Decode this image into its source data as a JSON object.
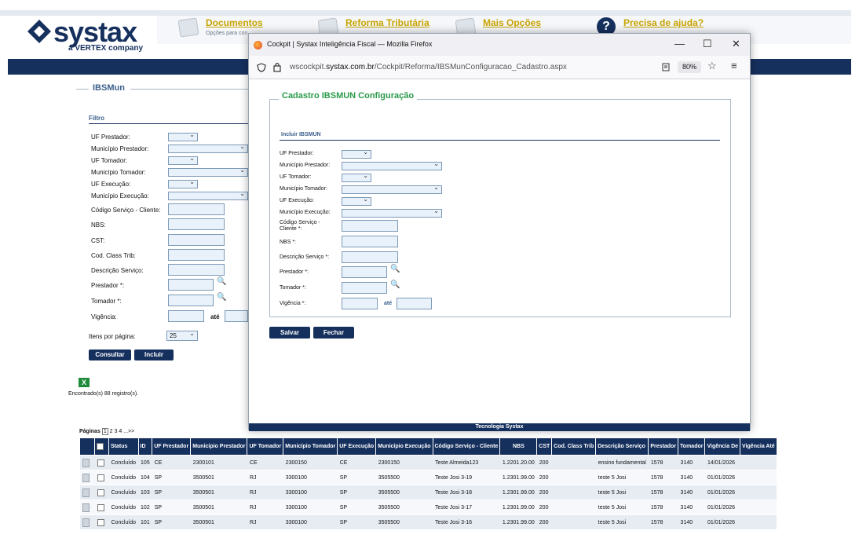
{
  "brand": {
    "name": "systax",
    "sub": "a VERTEX company"
  },
  "topnav": [
    {
      "title": "Documentos",
      "sub": "Opções para con"
    },
    {
      "title": "Reforma Tributária",
      "sub": ""
    },
    {
      "title": "Mais Opções",
      "sub": ""
    },
    {
      "title": "Precisa de ajuda?",
      "sub": ""
    }
  ],
  "help_glyph": "?",
  "filter": {
    "panel_title": "IBSMun",
    "section": "Filtro",
    "labels": [
      "UF Prestador:",
      "Município Prestador:",
      "UF Tomador:",
      "Município Tomador:",
      "UF Execução:",
      "Município Execução:",
      "Código Serviço - Cliente:",
      "NBS:",
      "CST:",
      "Cod. Class Trib:",
      "Descrição Serviço:",
      "Prestador *:",
      "Tomador *:",
      "Vigência:"
    ],
    "ate": "até",
    "itens_label": "Itens por página:",
    "itens_value": "25",
    "consultar": "Consultar",
    "incluir": "Incluir",
    "found": "Encontrado(s) 88 registro(s)."
  },
  "pages": {
    "label": "Páginas",
    "items": [
      "1",
      "2",
      "3",
      "4",
      "...",
      ">>"
    ]
  },
  "grid": {
    "headers": [
      "",
      "Status",
      "ID",
      "UF Prestador",
      "Município Prestador",
      "UF Tomador",
      "Município Tomador",
      "UF Execução",
      "Município Execução",
      "Código Serviço - Cliente",
      "NBS",
      "CST",
      "Cod. Class Trib",
      "Descrição Serviço",
      "Prestador",
      "Tomador",
      "Vigência De",
      "Vigência Até"
    ],
    "rows": [
      [
        "Concluído",
        "105",
        "CE",
        "2300101",
        "CE",
        "2300150",
        "CE",
        "2300150",
        "Teste Almeida123",
        "1.2201.20.00",
        "200",
        "",
        "ensino fundamental",
        "1578",
        "3140",
        "14/01/2026",
        ""
      ],
      [
        "Concluído",
        "104",
        "SP",
        "3500501",
        "RJ",
        "3300100",
        "SP",
        "3505500",
        "Teste Josi 3-19",
        "1.2301.99.00",
        "200",
        "",
        "teste 5 Josi",
        "1578",
        "3140",
        "01/01/2026",
        ""
      ],
      [
        "Concluído",
        "103",
        "SP",
        "3500501",
        "RJ",
        "3300100",
        "SP",
        "3505500",
        "Teste Josi 3-18",
        "1.2301.99.00",
        "200",
        "",
        "teste 5 Josi",
        "1578",
        "3140",
        "01/01/2026",
        ""
      ],
      [
        "Concluído",
        "102",
        "SP",
        "3500501",
        "RJ",
        "3300100",
        "SP",
        "3505500",
        "Teste Josi 3-17",
        "1.2301.99.00",
        "200",
        "",
        "teste 5 Josi",
        "1578",
        "3140",
        "01/01/2026",
        ""
      ],
      [
        "Concluído",
        "101",
        "SP",
        "3500501",
        "RJ",
        "3300100",
        "SP",
        "3505500",
        "Teste Josi 3-16",
        "1.2301.99.00",
        "200",
        "",
        "teste 5 Josi",
        "1578",
        "3140",
        "01/01/2026",
        ""
      ]
    ]
  },
  "browser": {
    "title": "Cockpit | Systax Inteligência Fiscal — Mozilla Firefox",
    "url_pre": "wscockpit.",
    "url_domain": "systax.com.br",
    "url_post": "/Cockpit/Reforma/IBSMunConfiguracao_Cadastro.aspx",
    "zoom": "80%",
    "min": "—",
    "max": "☐",
    "close": "✕"
  },
  "modal": {
    "title": "Cadastro IBSMUN Configuração",
    "section": "Incluir IBSMUN",
    "labels": [
      "UF Prestador:",
      "Município Prestador:",
      "UF Tomador:",
      "Município Tomador:",
      "UF Execução:",
      "Município Execução:",
      "Código Serviço - Cliente *:",
      "NBS *:",
      "Descrição Serviço *:",
      "Prestador *:",
      "Tomador *:",
      "Vigência *:"
    ],
    "ate": "até",
    "salvar": "Salvar",
    "fechar": "Fechar",
    "footer": "Tecnologia Systax"
  }
}
